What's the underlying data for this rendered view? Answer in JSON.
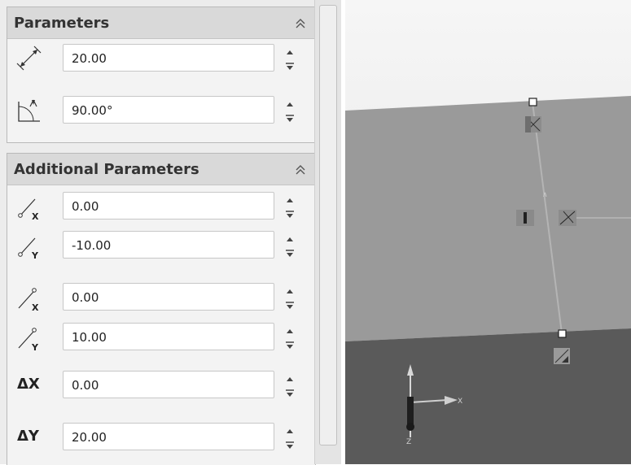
{
  "parameters": {
    "title": "Parameters",
    "distance_value": "20.00",
    "angle_value": "90.00°"
  },
  "additional": {
    "title": "Additional Parameters",
    "start_offset_x": "0.00",
    "start_offset_y": "-10.00",
    "end_offset_x": "0.00",
    "end_offset_y": "10.00",
    "delta_x_label": "ΔX",
    "delta_x_value": "0.00",
    "delta_y_label": "ΔY",
    "delta_y_value": "20.00"
  },
  "icons": {
    "collapse": "chevron-double-up-icon",
    "distance": "distance-icon",
    "angle": "angle-icon",
    "start_x": "start-point-x-icon",
    "start_y": "start-point-y-icon",
    "end_x": "end-point-x-icon",
    "end_y": "end-point-y-icon",
    "spin_up": "spin-up-icon",
    "spin_down": "spin-down-icon"
  },
  "colors": {
    "panel_bg": "#ececec",
    "header_bg": "#d9d9d9",
    "input_border": "#c7c7c7",
    "viewport_sky": "#eeeeee",
    "plane_top": "#9a9a9a",
    "plane_bottom": "#5a5a5a"
  }
}
